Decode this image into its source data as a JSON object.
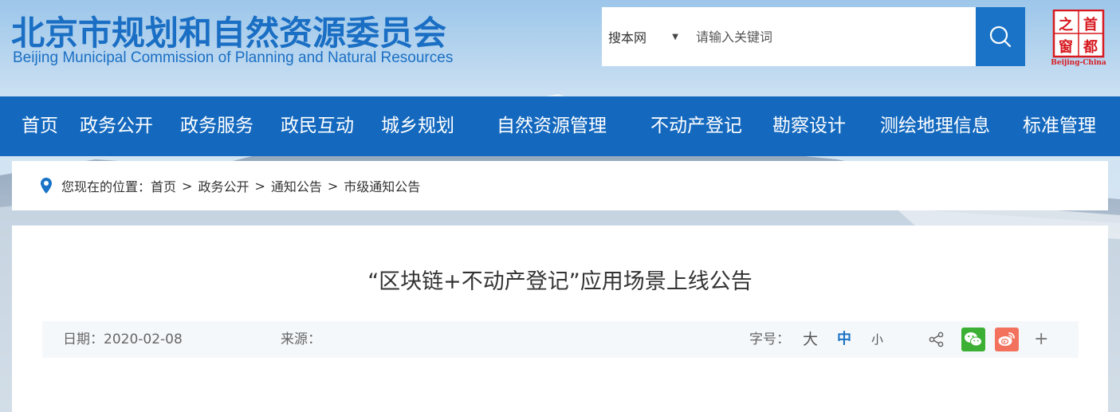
{
  "header": {
    "title": "北京市规划和自然资源委员会",
    "subtitle": "Beijing Municipal Commission of Planning and Natural Resources",
    "search": {
      "scope": "搜本网",
      "placeholder": "请输入关键词"
    },
    "seal": {
      "chars": [
        "首",
        "都",
        "之",
        "窗"
      ],
      "caption": "Beijing-China"
    }
  },
  "nav": {
    "items": [
      "首页",
      "政务公开",
      "政务服务",
      "政民互动",
      "城乡规划",
      "自然资源管理",
      "不动产登记",
      "勘察设计",
      "测绘地理信息",
      "标准管理"
    ]
  },
  "breadcrumb": {
    "prefix": "您现在的位置：",
    "items": [
      "首页",
      "政务公开",
      "通知公告",
      "市级通知公告"
    ],
    "separator": ">"
  },
  "article": {
    "title": "“区块链+不动产登记”应用场景上线公告",
    "date_label": "日期：",
    "date": "2020-02-08",
    "source_label": "来源：",
    "font_size_label": "字号：",
    "font_sizes": [
      "大",
      "中",
      "小"
    ],
    "selected_font_size": "中",
    "share_icons": [
      "share-icon",
      "wechat-icon",
      "weibo-icon",
      "plus-icon"
    ],
    "more": "+"
  },
  "colors": {
    "brand_blue": "#1a6fc4",
    "nav_blue": "#1469bf",
    "wechat_green": "#3cb034",
    "weibo_red": "#f2725e",
    "seal_red": "#d7191f"
  }
}
